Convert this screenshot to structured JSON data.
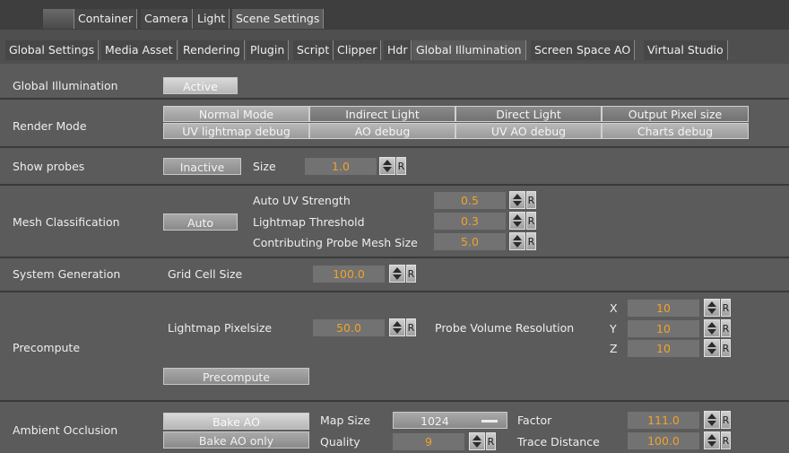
{
  "top_tabs": [
    "Container",
    "Camera",
    "Light",
    "Scene Settings"
  ],
  "sub_tabs": [
    "Global Settings",
    "Media Asset",
    "Rendering",
    "Plugin",
    "Script",
    "Clipper",
    "Hdr",
    "Global Illumination",
    "Screen Space AO",
    "Virtual Studio"
  ],
  "global_illumination": {
    "label": "Global Illumination",
    "button": "Active"
  },
  "render_mode": {
    "label": "Render Mode",
    "row1": [
      "Normal Mode",
      "Indirect Light",
      "Direct Light",
      "Output Pixel size"
    ],
    "row2": [
      "UV lightmap debug",
      "AO debug",
      "UV AO debug",
      "Charts debug"
    ]
  },
  "show_probes": {
    "label": "Show probes",
    "button": "Inactive",
    "size_label": "Size",
    "size_value": "1.0"
  },
  "mesh_classification": {
    "label": "Mesh Classification",
    "button": "Auto",
    "auto_uv_label": "Auto UV Strength",
    "auto_uv_value": "0.5",
    "lightmap_threshold_label": "Lightmap Threshold",
    "lightmap_threshold_value": "0.3",
    "probe_mesh_label": "Contributing Probe Mesh Size",
    "probe_mesh_value": "5.0"
  },
  "system_generation": {
    "label": "System Generation",
    "grid_label": "Grid Cell Size",
    "grid_value": "100.0"
  },
  "precompute": {
    "label": "Precompute",
    "pixelsize_label": "Lightmap Pixelsize",
    "pixelsize_value": "50.0",
    "probe_res_label": "Probe Volume Resolution",
    "x_label": "X",
    "x_value": "10",
    "y_label": "Y",
    "y_value": "10",
    "z_label": "Z",
    "z_value": "10",
    "button": "Precompute"
  },
  "ambient_occlusion": {
    "label": "Ambient Occlusion",
    "bake_button": "Bake AO",
    "bake_only_button": "Bake AO only",
    "map_size_label": "Map Size",
    "map_size_value": "1024",
    "quality_label": "Quality",
    "quality_value": "9",
    "factor_label": "Factor",
    "factor_value": "111.0",
    "trace_label": "Trace Distance",
    "trace_value": "100.0"
  },
  "reset_label": "R",
  "colors": {
    "value_text": "#f1a22b",
    "panel": "#5b5b5b",
    "separator": "#3a3a3a"
  }
}
